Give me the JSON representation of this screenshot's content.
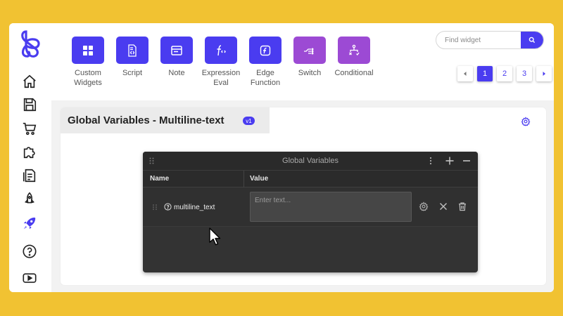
{
  "toolbar": {
    "tools": [
      {
        "label": "Custom\nWidgets",
        "icon": "grid-icon",
        "color": "#4a3cf0"
      },
      {
        "label": "Script",
        "icon": "script-icon",
        "color": "#4a3cf0"
      },
      {
        "label": "Note",
        "icon": "note-icon",
        "color": "#4a3cf0"
      },
      {
        "label": "Expression\nEval",
        "icon": "function-icon",
        "color": "#4a3cf0"
      },
      {
        "label": "Edge\nFunction",
        "icon": "edge-function-icon",
        "color": "#4a3cf0"
      },
      {
        "label": "Switch",
        "icon": "switch-icon",
        "color": "#9c4ad4"
      },
      {
        "label": "Conditional",
        "icon": "conditional-icon",
        "color": "#9c4ad4"
      }
    ],
    "search_placeholder": "Find widget",
    "pages": [
      "1",
      "2",
      "3"
    ],
    "active_page": "1"
  },
  "main": {
    "title": "Global Variables - Multiline-text",
    "version_badge": "v1"
  },
  "panel": {
    "title": "Global Variables",
    "columns": {
      "name": "Name",
      "value": "Value"
    },
    "rows": [
      {
        "name": "multiline_text",
        "value_placeholder": "Enter text..."
      }
    ]
  },
  "colors": {
    "accent": "#4a3cf0",
    "accent_purple": "#9c4ad4",
    "background": "#f1c232",
    "panel_dark": "#333333"
  }
}
